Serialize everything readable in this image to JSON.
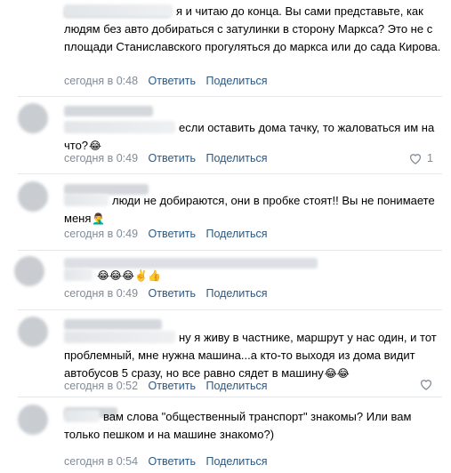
{
  "comments": [
    {
      "text": "я и читаю до конца. Вы сами представьте, как людям без авто добираться с затулинки в сторону Маркса? Это не с площади Станиславского прогуляться до маркса или до сада Кирова.",
      "lead": ",",
      "time": "сегодня в 0:48",
      "reply": "Ответить",
      "share": "Поделиться",
      "likes": ""
    },
    {
      "text": "если оставить дома тачку, то жаловаться им на что?",
      "emoji": "😂",
      "time": "сегодня в 0:49",
      "reply": "Ответить",
      "share": "Поделиться",
      "likes": "1"
    },
    {
      "text": "люди не добираются, они в пробке стоят!! Вы не понимаете меня",
      "emoji": "🤦‍♂️",
      "time": "сегодня в 0:49",
      "reply": "Ответить",
      "share": "Поделиться",
      "likes": ""
    },
    {
      "text": "",
      "emoji": "😂😂😂✌️👍",
      "time": "сегодня в 0:49",
      "reply": "Ответить",
      "share": "Поделиться",
      "likes": ""
    },
    {
      "text": "ну я живу в частнике, маршрут у нас один, и тот проблемный, мне нужна машина...а кто-то выходя из дома видит автобусов 5 сразу, но все равно сядет в машину",
      "emoji": "😂😂",
      "lead": ",",
      "time": "сегодня в 0:52",
      "reply": "Ответить",
      "share": "Поделиться",
      "likes": ""
    },
    {
      "text": "вам слова \"общественный транспорт\" знакомы? Или вам только пешком и на машине знакомо?)",
      "lead": ",",
      "time": "сегодня в 0:54",
      "reply": "Ответить",
      "share": "Поделиться",
      "likes": ""
    }
  ],
  "colors": {
    "meta": "#818c99",
    "link": "#2a5885",
    "divider": "#e7e8ec"
  }
}
